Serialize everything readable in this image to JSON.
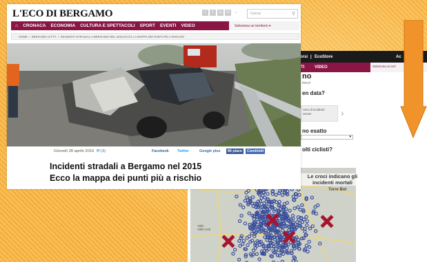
{
  "back_page": {
    "top_links": [
      "ncorsi",
      "|",
      "EcoStore",
      "Ac"
    ],
    "nav_items": [
      "TI",
      "VIDEO"
    ],
    "territory_label": "Seleziona un terr",
    "partial_texts": [
      "no",
      "mo.it",
      "en data?",
      "nero di incidenti",
      "oeose",
      "no esatto",
      "olti ciclisti?"
    ],
    "map_label_top": "Torre Bol",
    "map_label_left": "Valle\nValle-Sub",
    "map_note": "Le croci indicano gli incidenti mortali"
  },
  "front_page": {
    "logo": "L'ECO DI BERGAMO",
    "search_placeholder": "Cerca",
    "social_icons": [
      "twitter-icon",
      "facebook-icon",
      "google-plus-icon",
      "mail-icon",
      "rss-icon"
    ],
    "nav_items": [
      "CRONACA",
      "ECONOMIA",
      "CULTURA E SPETTACOLI",
      "SPORT",
      "EVENTI",
      "VIDEO"
    ],
    "territory": "Seleziona un territorio ▾",
    "breadcrumb": [
      "HOME",
      "/",
      "BERGAMO CITTÀ",
      "/",
      "INCIDENTI STRADALI A BERGAMO NEL 2015 ECCO LA MAPPA DEI PUNTI PIÙ A RISCHIO"
    ],
    "date": "Giovedì 28 aprile 2016",
    "comments": "(3)",
    "share": [
      "Facebook",
      "Twitter",
      "Google plus",
      "Mi piace",
      "Condividi"
    ],
    "headline_line1": "Incidenti stradali a Bergamo nel 2015",
    "headline_line2": "Ecco la mappa dei punti più a rischio"
  },
  "colors": {
    "background": "#f6b446",
    "nav": "#8a1645",
    "arrow": "#f0932a",
    "map_cross": "#a8142e",
    "map_dot": "#3a4f9c"
  }
}
